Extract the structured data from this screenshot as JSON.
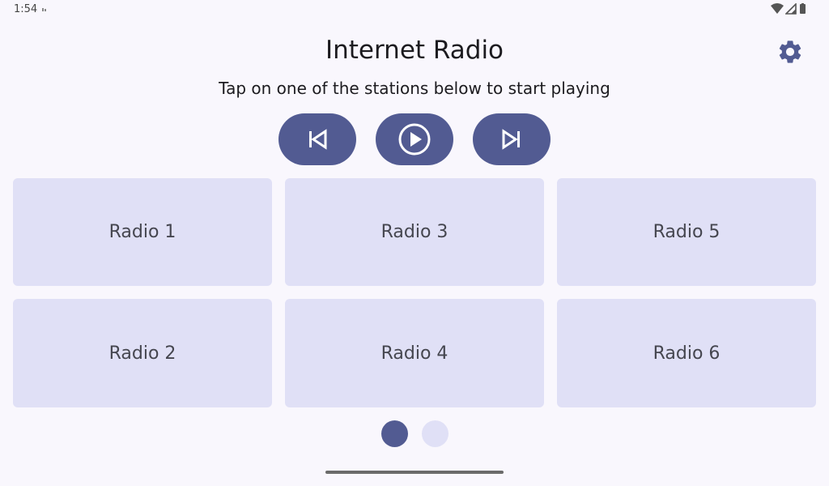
{
  "status_bar": {
    "time": "1:54",
    "icons": [
      "notification-icon",
      "wifi-icon",
      "signal-icon",
      "battery-icon"
    ]
  },
  "header": {
    "title": "Internet Radio",
    "settings_icon": "gear-icon"
  },
  "subtitle": "Tap on one of the stations below to start playing",
  "controls": {
    "previous_icon": "skip-previous-icon",
    "play_icon": "play-circle-icon",
    "next_icon": "skip-next-icon"
  },
  "stations": [
    {
      "label": "Radio 1"
    },
    {
      "label": "Radio 3"
    },
    {
      "label": "Radio 5"
    },
    {
      "label": "Radio 2"
    },
    {
      "label": "Radio 4"
    },
    {
      "label": "Radio 6"
    }
  ],
  "pager": {
    "pages": 2,
    "current": 1
  },
  "colors": {
    "background": "#f9f7fd",
    "accent": "#525b92",
    "tile": "#e0e0f6",
    "tile_text": "#45464f"
  }
}
